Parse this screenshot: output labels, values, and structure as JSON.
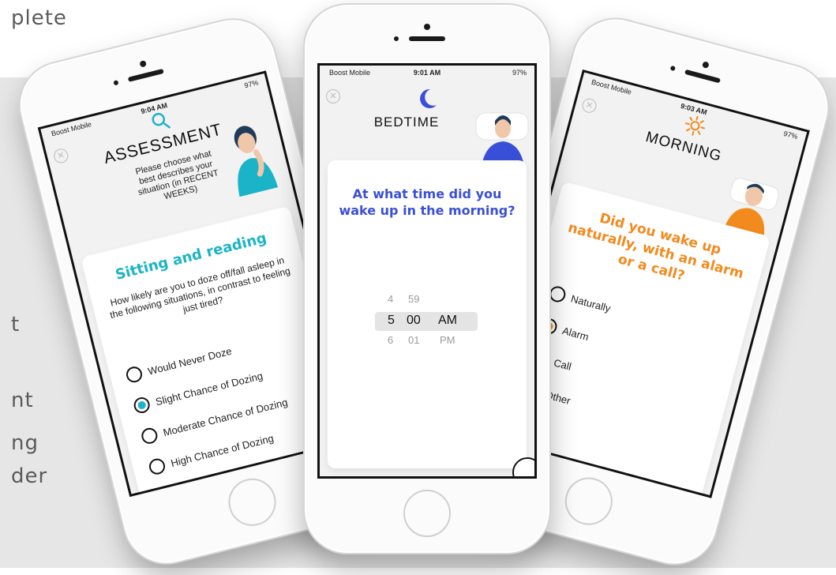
{
  "background": {
    "panel_color": "#e6e6e6",
    "text_fragments": [
      "plete",
      "t",
      "nt",
      "ng",
      "der"
    ]
  },
  "phone_left": {
    "status": {
      "carrier": "Boost Mobile",
      "time": "9:04 AM",
      "battery": "97%"
    },
    "title": "ASSESSMENT",
    "subtitle": "Please choose what best describes your situation (in RECENT WEEKS)",
    "card_title": "Sitting and reading",
    "question": "How likely are you to doze off/fall asleep in the following situations, in contrast to feeling just tired?",
    "options": [
      "Would Never Doze",
      "Slight Chance of Dozing",
      "Moderate Chance of Dozing",
      "High Chance of Dozing"
    ],
    "selected_index": 1,
    "accent": "#1bb3c8"
  },
  "phone_center": {
    "status": {
      "carrier": "Boost Mobile",
      "time": "9:01 AM",
      "battery": "97%"
    },
    "title": "BEDTIME",
    "question": "At what time did you wake up in the morning?",
    "picker": {
      "hours": [
        "4",
        "5",
        "6"
      ],
      "minutes": [
        "59",
        "00",
        "01"
      ],
      "periods": [
        "AM",
        "PM"
      ],
      "selected": {
        "hour": "5",
        "minute": "00",
        "period": "AM"
      }
    },
    "accent": "#3a4fd8"
  },
  "phone_right": {
    "status": {
      "carrier": "Boost Mobile",
      "time": "9:03 AM",
      "battery": "97%"
    },
    "title": "MORNING",
    "question": "Did you wake up naturally, with an alarm or a call?",
    "options": [
      "Naturally",
      "Alarm",
      "Call",
      "Other"
    ],
    "selected_index": 1,
    "accent": "#f28a1d"
  }
}
